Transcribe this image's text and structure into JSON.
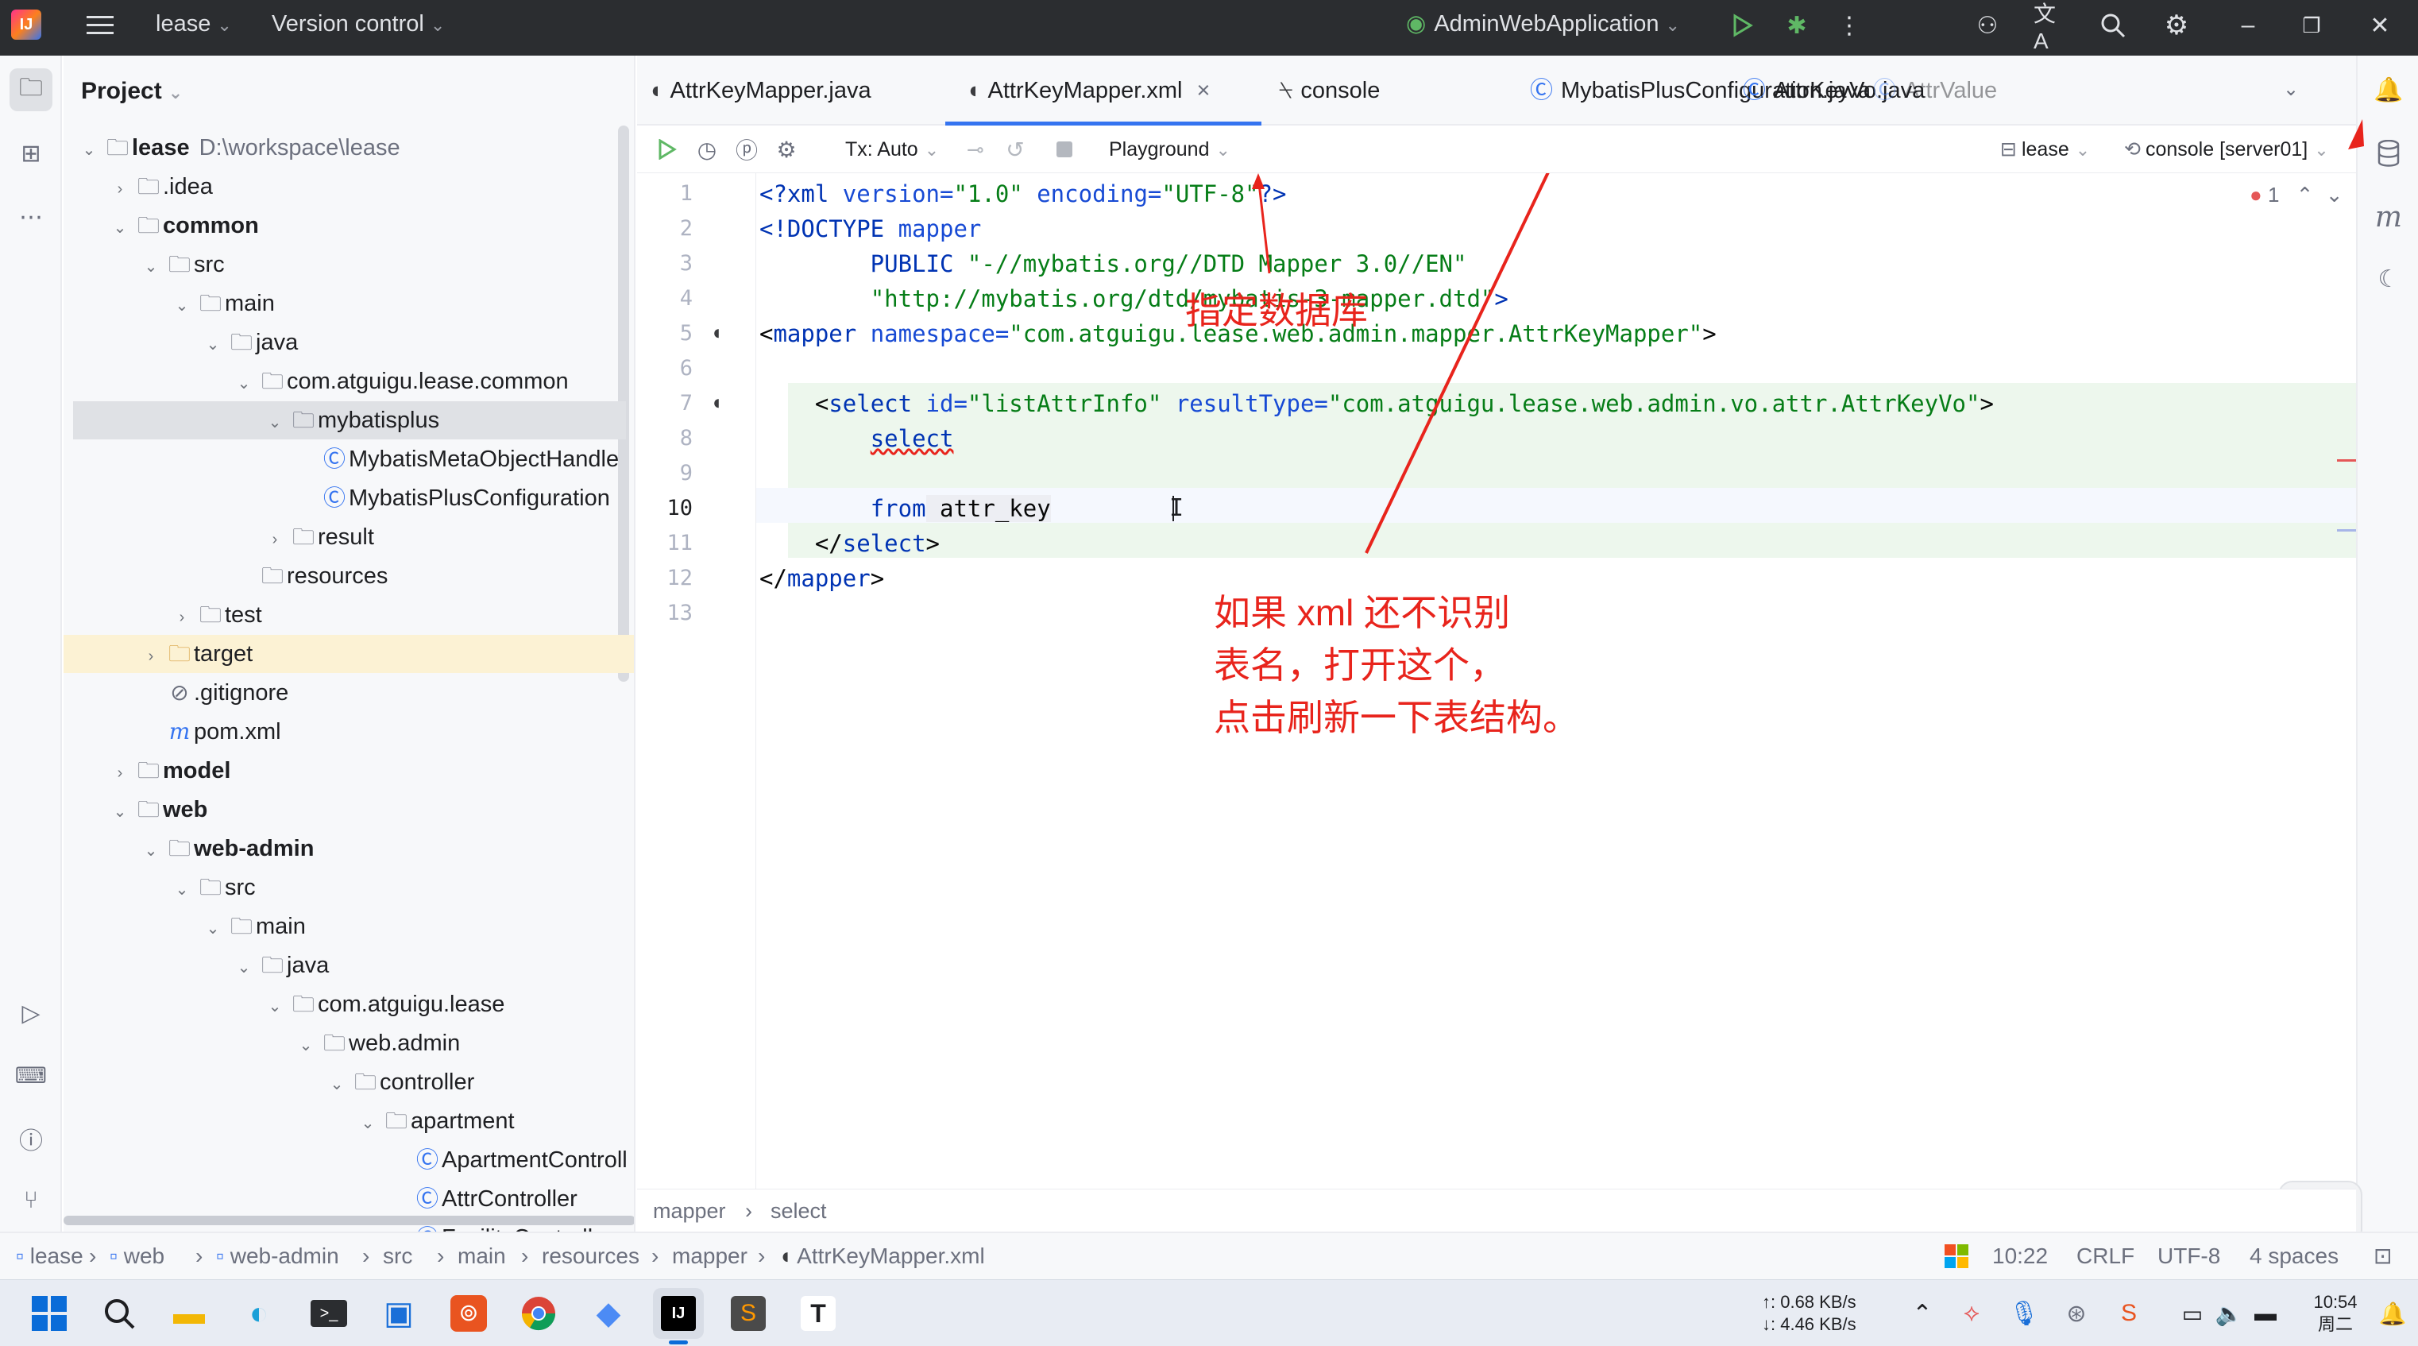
{
  "titlebar": {
    "project": "lease",
    "vcs": "Version control",
    "run_config": "AdminWebApplication"
  },
  "project_panel": {
    "title": "Project"
  },
  "tree": [
    {
      "label": "lease",
      "path": "D:\\workspace\\lease",
      "arrow": "v",
      "icon": "module",
      "bold": true,
      "depth": 0
    },
    {
      "label": ".idea",
      "arrow": ">",
      "icon": "folder",
      "depth": 1
    },
    {
      "label": "common",
      "arrow": "v",
      "icon": "module",
      "bold": true,
      "depth": 1
    },
    {
      "label": "src",
      "arrow": "v",
      "icon": "folder",
      "depth": 2
    },
    {
      "label": "main",
      "arrow": "v",
      "icon": "folder",
      "depth": 3
    },
    {
      "label": "java",
      "arrow": "v",
      "icon": "folder",
      "depth": 4
    },
    {
      "label": "com.atguigu.lease.common",
      "arrow": "v",
      "icon": "package",
      "depth": 5
    },
    {
      "label": "mybatisplus",
      "arrow": "v",
      "icon": "package",
      "depth": 6,
      "selected": true
    },
    {
      "label": "MybatisMetaObjectHandle",
      "arrow": "",
      "icon": "class",
      "depth": 7
    },
    {
      "label": "MybatisPlusConfiguration",
      "arrow": "",
      "icon": "class",
      "depth": 7
    },
    {
      "label": "result",
      "arrow": ">",
      "icon": "package",
      "depth": 6
    },
    {
      "label": "resources",
      "arrow": "",
      "icon": "folder",
      "depth": 5
    },
    {
      "label": "test",
      "arrow": ">",
      "icon": "folder",
      "depth": 3
    },
    {
      "label": "target",
      "arrow": ">",
      "icon": "folder",
      "depth": 2,
      "excluded": true
    },
    {
      "label": ".gitignore",
      "arrow": "",
      "icon": "ignore",
      "depth": 2
    },
    {
      "label": "pom.xml",
      "arrow": "",
      "icon": "maven",
      "depth": 2
    },
    {
      "label": "model",
      "arrow": ">",
      "icon": "module",
      "bold": true,
      "depth": 1
    },
    {
      "label": "web",
      "arrow": "v",
      "icon": "module",
      "bold": true,
      "depth": 1
    },
    {
      "label": "web-admin",
      "arrow": "v",
      "icon": "module",
      "bold": true,
      "depth": 2
    },
    {
      "label": "src",
      "arrow": "v",
      "icon": "folder",
      "depth": 3
    },
    {
      "label": "main",
      "arrow": "v",
      "icon": "folder",
      "depth": 4
    },
    {
      "label": "java",
      "arrow": "v",
      "icon": "folder",
      "depth": 5
    },
    {
      "label": "com.atguigu.lease",
      "arrow": "v",
      "icon": "package",
      "depth": 6
    },
    {
      "label": "web.admin",
      "arrow": "v",
      "icon": "package",
      "depth": 7
    },
    {
      "label": "controller",
      "arrow": "v",
      "icon": "package",
      "depth": 8
    },
    {
      "label": "apartment",
      "arrow": "v",
      "icon": "package",
      "depth": 9
    },
    {
      "label": "ApartmentControll",
      "arrow": "",
      "icon": "class",
      "depth": 10
    },
    {
      "label": "AttrController",
      "arrow": "",
      "icon": "class",
      "depth": 10
    },
    {
      "label": "FacilityController",
      "arrow": "",
      "icon": "class",
      "depth": 10
    }
  ],
  "tabs": [
    {
      "label": "AttrKeyMapper.java",
      "icon": "mybatis"
    },
    {
      "label": "AttrKeyMapper.xml",
      "icon": "mybatis",
      "active": true,
      "close": "×"
    },
    {
      "label": "console",
      "icon": "console"
    },
    {
      "label": "MybatisPlusConfiguration.java",
      "icon": "class"
    },
    {
      "label": "AttrKeyVo.java",
      "icon": "class"
    },
    {
      "label": "AttrValue",
      "icon": "class"
    }
  ],
  "toolbar": {
    "tx": "Tx: Auto",
    "playground": "Playground",
    "datasource": "lease",
    "session": "console [server01]",
    "problems": "1"
  },
  "code_lines": [
    "1",
    "2",
    "3",
    "4",
    "5",
    "6",
    "7",
    "8",
    "9",
    "10",
    "11",
    "12",
    "13"
  ],
  "code": {
    "l1": [
      "<?",
      "xml",
      " version=",
      "\"1.0\"",
      " encoding=",
      "\"UTF-8\"",
      "?>"
    ],
    "l2": [
      "<!DOCTYPE",
      " mapper"
    ],
    "l3": [
      "        PUBLIC ",
      "\"-//mybatis.org//DTD Mapper 3.0//EN\""
    ],
    "l4": [
      "        ",
      "\"http://mybatis.org/dtd/mybatis-3-mapper.dtd\"",
      ">"
    ],
    "l5": [
      "<",
      "mapper",
      " namespace=",
      "\"com.atguigu.lease.web.admin.mapper.AttrKeyMapper\"",
      ">"
    ],
    "l7": [
      "    <",
      "select",
      " id=",
      "\"listAttrInfo\"",
      " resultType=",
      "\"com.atguigu.lease.web.admin.vo.attr.AttrKeyVo\"",
      ">"
    ],
    "l8": [
      "        ",
      "select"
    ],
    "l10": [
      "        ",
      "from",
      " attr_key"
    ],
    "l11": [
      "    </",
      "select",
      ">"
    ],
    "l12": [
      "</",
      "mapper",
      ">"
    ]
  },
  "breadcrumb": [
    "mapper",
    "select"
  ],
  "status": {
    "path": [
      "lease",
      "web",
      "web-admin",
      "src",
      "main",
      "resources",
      "mapper",
      "AttrKeyMapper.xml"
    ],
    "position": "10:22",
    "line_sep": "CRLF",
    "encoding": "UTF-8",
    "indent": "4 spaces"
  },
  "annotations": {
    "db": "指定数据库",
    "hint": [
      "如果 xml 还不识别",
      "表名，打开这个，",
      "点击刷新一下表结构。"
    ]
  },
  "taskbar": {
    "net_up": "↑: 0.68 KB/s",
    "net_down": "↓: 4.46 KB/s",
    "time": "10:54",
    "day": "周二"
  },
  "colors": {
    "accent": "#3574f0",
    "annotation": "#e8241c",
    "titlebar": "#2b2d30"
  }
}
